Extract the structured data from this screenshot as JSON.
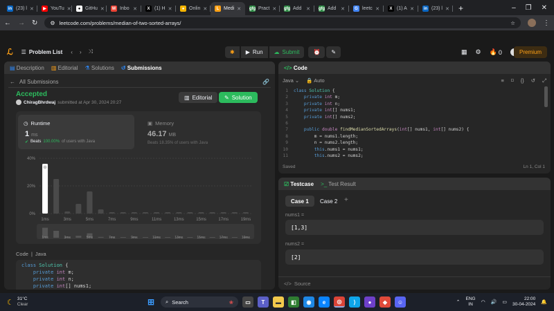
{
  "browser": {
    "tabs": [
      {
        "title": "(23) l",
        "fav": "in",
        "color": "#0a66c2",
        "active": false
      },
      {
        "title": "YouTu",
        "fav": "▶",
        "color": "#ff0000",
        "active": false
      },
      {
        "title": "GitHu",
        "fav": "●",
        "color": "#ffffff",
        "active": false
      },
      {
        "title": "Inbo",
        "fav": "M",
        "color": "#ea4335",
        "active": false
      },
      {
        "title": "(1) H",
        "fav": "X",
        "color": "#000000",
        "active": false
      },
      {
        "title": "Onlin",
        "fav": "●",
        "color": "#f4b400",
        "active": false
      },
      {
        "title": "Medi",
        "fav": "L",
        "color": "#ffa116",
        "active": true
      },
      {
        "title": "Pract",
        "fav": "gfg",
        "color": "#2f8d46",
        "active": false
      },
      {
        "title": "Add",
        "fav": "gfg",
        "color": "#2f8d46",
        "active": false
      },
      {
        "title": "Add",
        "fav": "gfg",
        "color": "#2f8d46",
        "active": false
      },
      {
        "title": "leetc",
        "fav": "G",
        "color": "#4285f4",
        "active": false
      },
      {
        "title": "(1) A",
        "fav": "X",
        "color": "#000000",
        "active": false
      },
      {
        "title": "(23) l",
        "fav": "in",
        "color": "#0a66c2",
        "active": false
      }
    ],
    "new_tab": "+",
    "url": "leetcode.com/problems/median-of-two-sorted-arrays/"
  },
  "nav": {
    "problem_list": "Problem List",
    "run": "Run",
    "submit": "Submit",
    "fire_count": "0",
    "premium": "Premium"
  },
  "left_tabs": {
    "description": "Description",
    "editorial": "Editorial",
    "solutions": "Solutions",
    "submissions": "Submissions"
  },
  "submission": {
    "back": "All Submissions",
    "status": "Accepted",
    "user": "ChiragBhrdwaj",
    "submitted_at": "submitted at Apr 30, 2024 20:27",
    "editorial_btn": "Editorial",
    "solution_btn": "Solution",
    "runtime_label": "Runtime",
    "runtime_value": "1",
    "runtime_unit": "ms",
    "runtime_beats_prefix": "Beats",
    "runtime_beats_pct": "100.00%",
    "runtime_beats_suffix": "of users with Java",
    "memory_label": "Memory",
    "memory_value": "46.17",
    "memory_unit": "MB",
    "memory_beats": "Beats 18.35% of users with Java",
    "code_label": "Code",
    "code_lang": "Java",
    "code_preview": [
      "class Solution {",
      "    private int m;",
      "    private int n;",
      "    private int[] nums1;"
    ]
  },
  "chart_data": {
    "type": "bar",
    "categories": [
      "1ms",
      "2ms",
      "3ms",
      "4ms",
      "5ms",
      "6ms",
      "7ms",
      "8ms",
      "9ms",
      "10ms",
      "11ms",
      "12ms",
      "13ms",
      "14ms",
      "15ms",
      "16ms",
      "17ms",
      "18ms",
      "19ms"
    ],
    "tick_labels": [
      "1ms",
      "3ms",
      "5ms",
      "7ms",
      "9ms",
      "11ms",
      "13ms",
      "15ms",
      "17ms",
      "19ms"
    ],
    "yticks": [
      "40%",
      "20%",
      "0%"
    ],
    "values": [
      36,
      25,
      1.5,
      7,
      16,
      3,
      1,
      1,
      1,
      1,
      1,
      1,
      1,
      1,
      1,
      1,
      1,
      1,
      1
    ],
    "highlight_index": 0,
    "ylim": [
      0,
      40
    ],
    "colors": {
      "highlight": "#ffffff",
      "bar": "#4a4a4a"
    }
  },
  "editor": {
    "title": "Code",
    "lang": "Java",
    "auto": "Auto",
    "saved": "Saved",
    "cursor": "Ln 1, Col 1",
    "lines": [
      "class Solution {",
      "    private int m;",
      "    private int n;",
      "    private int[] nums1;",
      "    private int[] nums2;",
      "",
      "    public double findMedianSortedArrays(int[] nums1, int[] nums2) {",
      "        m = nums1.length;",
      "        n = nums2.length;",
      "        this.nums1 = nums1;",
      "        this.nums2 = nums2;"
    ]
  },
  "testcase": {
    "tab": "Testcase",
    "result_tab": "Test Result",
    "case1": "Case 1",
    "case2": "Case 2",
    "add": "+",
    "var1": "nums1 =",
    "val1": "[1,3]",
    "var2": "nums2 =",
    "val2": "[2]",
    "source": "Source"
  },
  "taskbar": {
    "temp": "31°C",
    "weather": "Clear",
    "search": "Search",
    "lang1": "ENG",
    "lang2": "IN",
    "time": "22:00",
    "date": "30-04-2024"
  }
}
